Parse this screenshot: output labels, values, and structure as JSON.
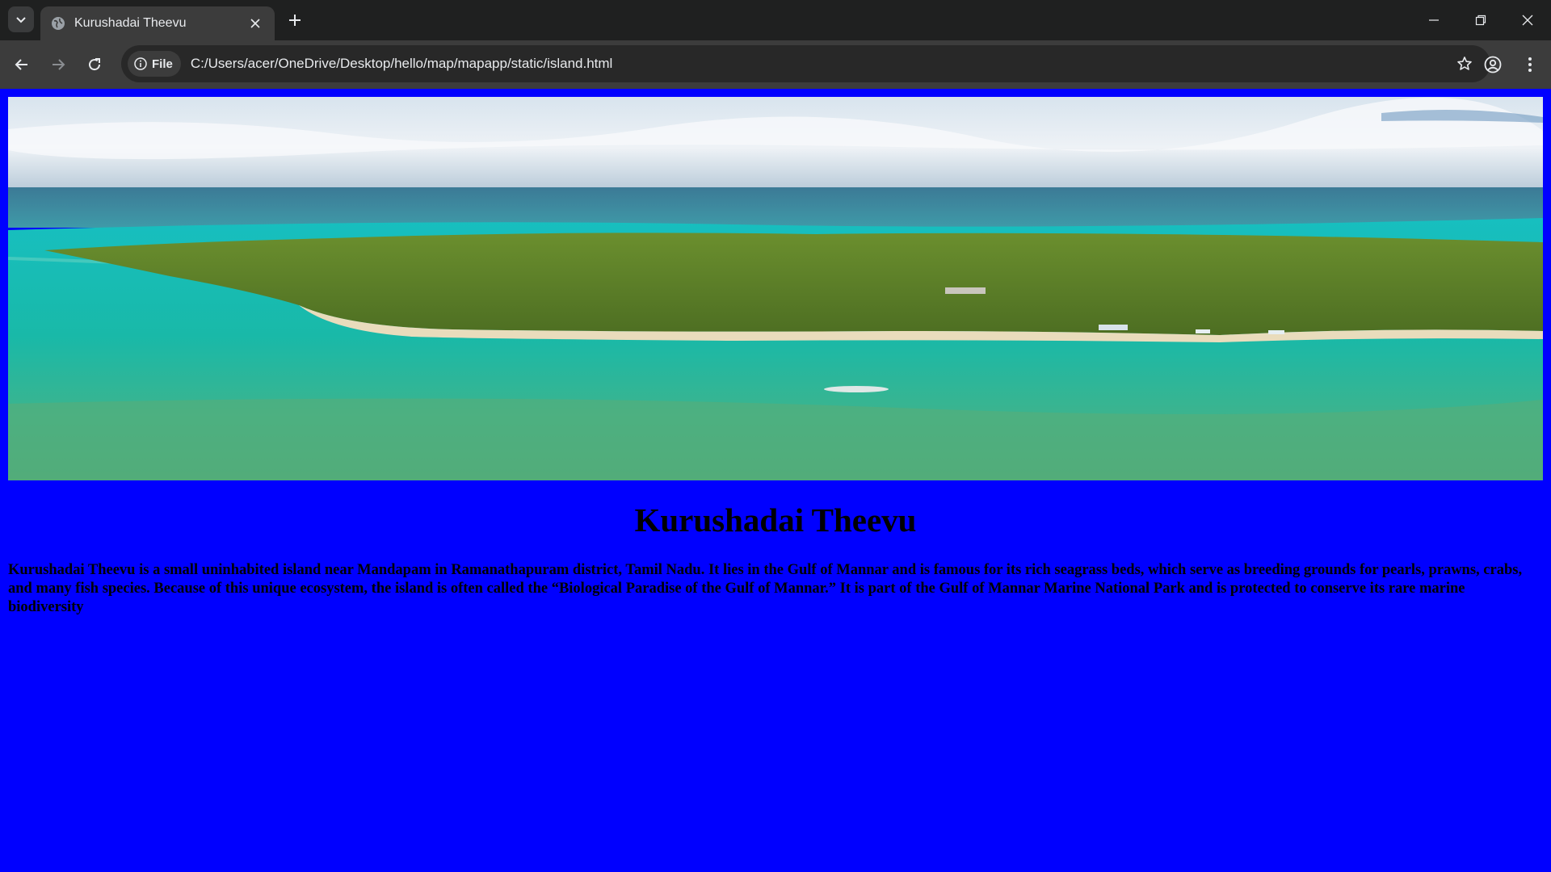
{
  "browser": {
    "tab": {
      "title": "Kurushadai Theevu"
    },
    "address_bar": {
      "chip_label": "File",
      "url": "C:/Users/acer/OneDrive/Desktop/hello/map/mapapp/static/island.html"
    }
  },
  "page": {
    "background_color": "#0000ff",
    "title": "Kurushadai Theevu",
    "description": "Kurushadai Theevu is a small uninhabited island near Mandapam in Ramanathapuram district, Tamil Nadu. It lies in the Gulf of Mannar and is famous for its rich seagrass beds, which serve as breeding grounds for pearls, prawns, crabs, and many fish species. Because of this unique ecosystem, the island is often called the “Biological Paradise of the Gulf of Mannar.” It is part of the Gulf of Mannar Marine National Park and is protected to conserve its rare marine biodiversity"
  }
}
